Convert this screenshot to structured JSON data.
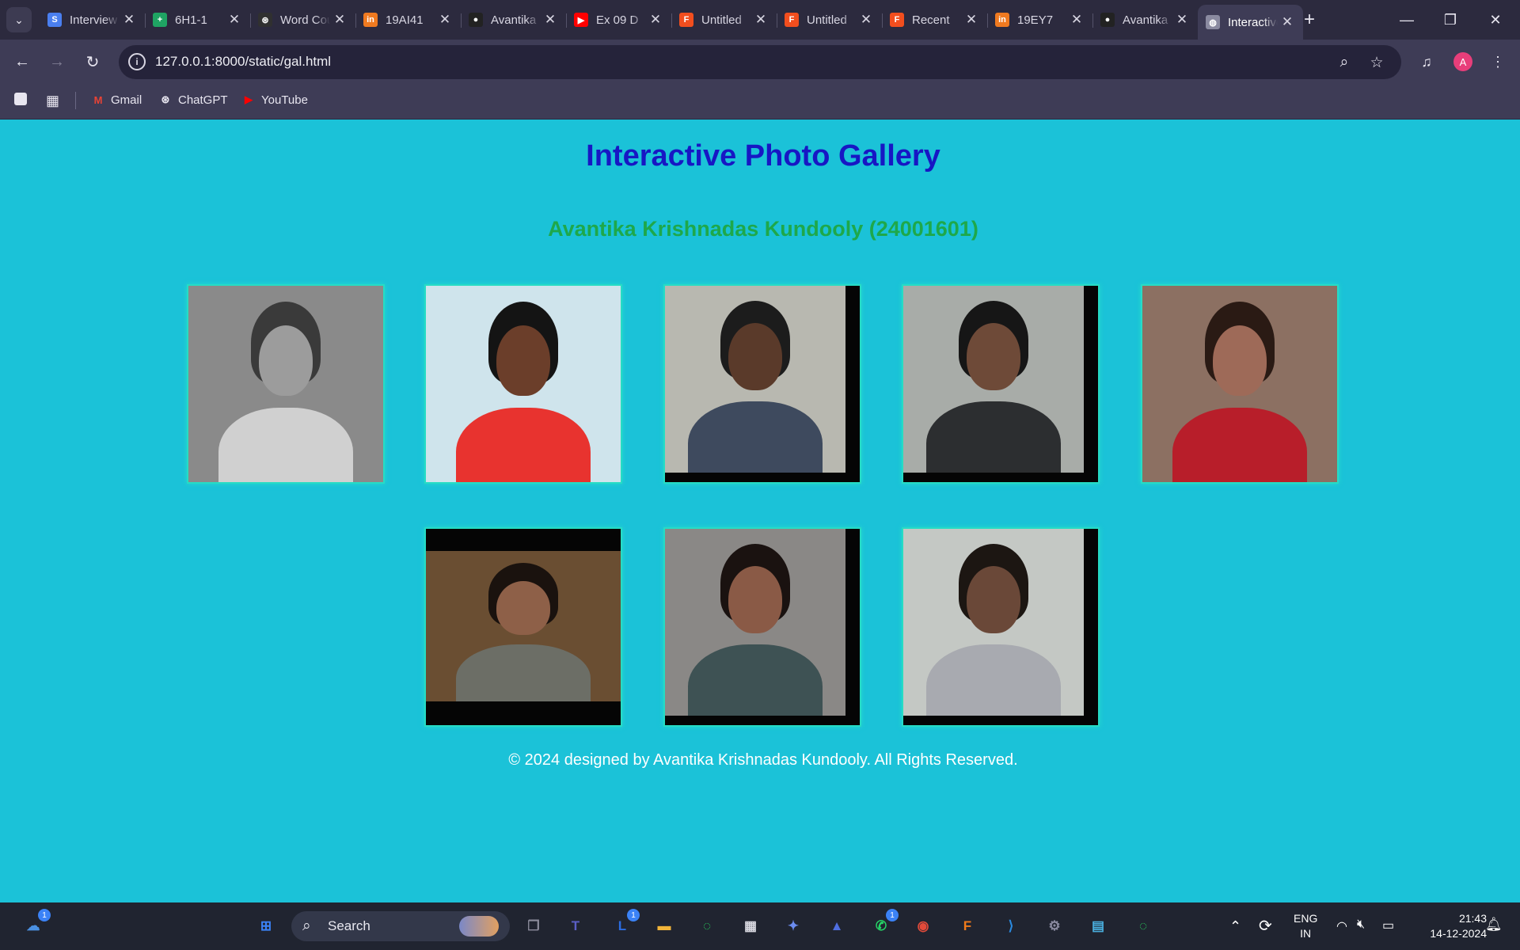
{
  "browser": {
    "tabs": [
      {
        "title": "Interview",
        "favicon": "S",
        "favicon_color": "#4a7ff0",
        "active": false
      },
      {
        "title": "6H1-1",
        "favicon": "+",
        "favicon_color": "#1fa463",
        "active": false
      },
      {
        "title": "Word Counter",
        "favicon": "⊛",
        "favicon_color": "#303030",
        "active": false
      },
      {
        "title": "19AI41",
        "favicon": "in",
        "favicon_color": "#f07a20",
        "active": false
      },
      {
        "title": "Avantika",
        "favicon": "●",
        "favicon_color": "#222222",
        "active": false
      },
      {
        "title": "Ex 09 D",
        "favicon": "▶",
        "favicon_color": "#ff0000",
        "active": false
      },
      {
        "title": "Untitled",
        "favicon": "F",
        "favicon_color": "#f24e1e",
        "active": false
      },
      {
        "title": "Untitled",
        "favicon": "F",
        "favicon_color": "#f24e1e",
        "active": false
      },
      {
        "title": "Recent",
        "favicon": "F",
        "favicon_color": "#f24e1e",
        "active": false
      },
      {
        "title": "19EY7",
        "favicon": "in",
        "favicon_color": "#f07a20",
        "active": false
      },
      {
        "title": "Avantika",
        "favicon": "●",
        "favicon_color": "#222222",
        "active": false
      },
      {
        "title": "Interactive",
        "favicon": "◍",
        "favicon_color": "#8a8aa0",
        "active": true
      }
    ],
    "tab_close_glyph": "✕",
    "new_tab_glyph": "+",
    "url": "127.0.0.1:8000/static/gal.html",
    "profile_initial": "A",
    "bookmarks": [
      {
        "label": "Gmail",
        "icon": "M",
        "color": "#ea4335"
      },
      {
        "label": "ChatGPT",
        "icon": "⊛",
        "color": "#e8e6f0"
      },
      {
        "label": "YouTube",
        "icon": "▶",
        "color": "#ff0000"
      }
    ]
  },
  "page": {
    "title": "Interactive Photo Gallery",
    "subtitle": "Avantika Krishnadas Kundooly (24001601)",
    "footer": "© 2024 designed by Avantika Krishnadas Kundooly. All Rights Reserved.",
    "photos": [
      {
        "label": "photo-1",
        "bg": "#8a8a8a",
        "skin": "#9c9c9c",
        "hair": "#3a3a3a",
        "shirt": "#d0d0d0",
        "letterbox": "none"
      },
      {
        "label": "photo-2",
        "bg": "#cfe4ec",
        "skin": "#6b3e2a",
        "hair": "#141414",
        "shirt": "#e8332f",
        "letterbox": "none"
      },
      {
        "label": "photo-3",
        "bg": "#b8b8b0",
        "skin": "#5a3a2a",
        "hair": "#1c1c1c",
        "shirt": "#3e4a5e",
        "letterbox": "right"
      },
      {
        "label": "photo-4",
        "bg": "#a8aca8",
        "skin": "#6e4a38",
        "hair": "#161616",
        "shirt": "#2c2e30",
        "letterbox": "right"
      },
      {
        "label": "photo-5",
        "bg": "#8c7062",
        "skin": "#9e6a58",
        "hair": "#2a1a14",
        "shirt": "#b81e2a",
        "letterbox": "none"
      },
      {
        "label": "photo-6",
        "bg": "#6a4e32",
        "skin": "#8e6048",
        "hair": "#1a120e",
        "shirt": "#6c6e66",
        "letterbox": "topbottom"
      },
      {
        "label": "photo-7",
        "bg": "#8a8886",
        "skin": "#8a5a46",
        "hair": "#1a1210",
        "shirt": "#3e5254",
        "letterbox": "right"
      },
      {
        "label": "photo-8",
        "bg": "#c4c8c4",
        "skin": "#6a4838",
        "hair": "#1c1612",
        "shirt": "#a8aab0",
        "letterbox": "right"
      }
    ]
  },
  "taskbar": {
    "search_label": "Search",
    "apps": [
      {
        "name": "widgets",
        "glyph": "☁",
        "color": "#4a90e2",
        "badge": "1"
      },
      {
        "name": "start",
        "glyph": "⊞",
        "color": "#3b82f6",
        "badge": ""
      },
      {
        "name": "task-view",
        "glyph": "❐",
        "color": "#8c8c9c",
        "badge": ""
      },
      {
        "name": "teams",
        "glyph": "T",
        "color": "#5b5fc7",
        "badge": ""
      },
      {
        "name": "lens-app",
        "glyph": "L",
        "color": "#2b6ce0",
        "badge": "1"
      },
      {
        "name": "file-explorer",
        "glyph": "▬",
        "color": "#f2b53a",
        "badge": ""
      },
      {
        "name": "loader-app",
        "glyph": "◌",
        "color": "#27c85a",
        "badge": ""
      },
      {
        "name": "microsoft-store",
        "glyph": "▦",
        "color": "#d8d8e0",
        "badge": ""
      },
      {
        "name": "copilot",
        "glyph": "✦",
        "color": "#6b8cf0",
        "badge": ""
      },
      {
        "name": "arc-app",
        "glyph": "▲",
        "color": "#4f6ee0",
        "badge": ""
      },
      {
        "name": "whatsapp",
        "glyph": "✆",
        "color": "#25d366",
        "badge": "1"
      },
      {
        "name": "chrome",
        "glyph": "◉",
        "color": "#e24a3a",
        "badge": ""
      },
      {
        "name": "fusion-app",
        "glyph": "F",
        "color": "#f07a1a",
        "badge": ""
      },
      {
        "name": "vscode",
        "glyph": "⟩",
        "color": "#2a8ae0",
        "badge": ""
      },
      {
        "name": "settings",
        "glyph": "⚙",
        "color": "#8a8aa0",
        "badge": ""
      },
      {
        "name": "notepad",
        "glyph": "▤",
        "color": "#4ab0e0",
        "badge": ""
      },
      {
        "name": "loader-app-2",
        "glyph": "◌",
        "color": "#27c85a",
        "badge": ""
      }
    ],
    "tray": {
      "language_line1": "ENG",
      "language_line2": "IN",
      "time": "21:43",
      "date": "14-12-2024"
    }
  }
}
